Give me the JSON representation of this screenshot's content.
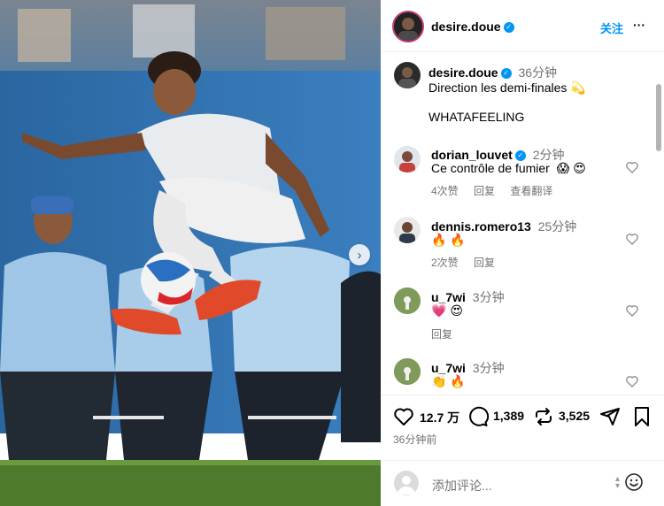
{
  "post": {
    "author": "desire.doue",
    "follow_label": "关注",
    "more_label": "···",
    "caption": {
      "author": "desire.doue",
      "time": "36分钟",
      "line1": "Direction les demi-finales",
      "line1_emoji": "💫",
      "line2": "WHATAFEELING"
    }
  },
  "comments": [
    {
      "user": "dorian_louvet",
      "verified": true,
      "time": "2分钟",
      "text": "Ce contrôle de fumier",
      "emojis": [
        "😱",
        "😍"
      ],
      "likes": "4次赞",
      "reply": "回复",
      "translate": "查看翻译"
    },
    {
      "user": "dennis.romero13",
      "verified": false,
      "time": "25分钟",
      "text": "",
      "emojis": [
        "🔥",
        "🔥"
      ],
      "likes": "2次赞",
      "reply": "回复",
      "translate": ""
    },
    {
      "user": "u_7wi",
      "verified": false,
      "time": "3分钟",
      "text": "",
      "emojis": [
        "💗",
        "😍"
      ],
      "likes": "",
      "reply": "回复",
      "translate": ""
    },
    {
      "user": "u_7wi",
      "verified": false,
      "time": "3分钟",
      "text": "",
      "emojis": [
        "👏",
        "🔥"
      ],
      "likes": "",
      "reply": "",
      "translate": ""
    }
  ],
  "actions": {
    "likes": "12.7 万",
    "comments": "1,389",
    "reposts": "3,525",
    "posted": "36分钟前"
  },
  "composer": {
    "placeholder": "添加评论..."
  },
  "colors": {
    "verified": "#0095f6",
    "muted": "#737373",
    "pitch_blue": "#2f6fa8",
    "grass": "#4d7a2c"
  },
  "icons": [
    "heart-icon",
    "comment-icon",
    "repost-icon",
    "share-icon",
    "bookmark-icon",
    "emoji-icon",
    "chevron-right-icon",
    "verified-icon"
  ]
}
